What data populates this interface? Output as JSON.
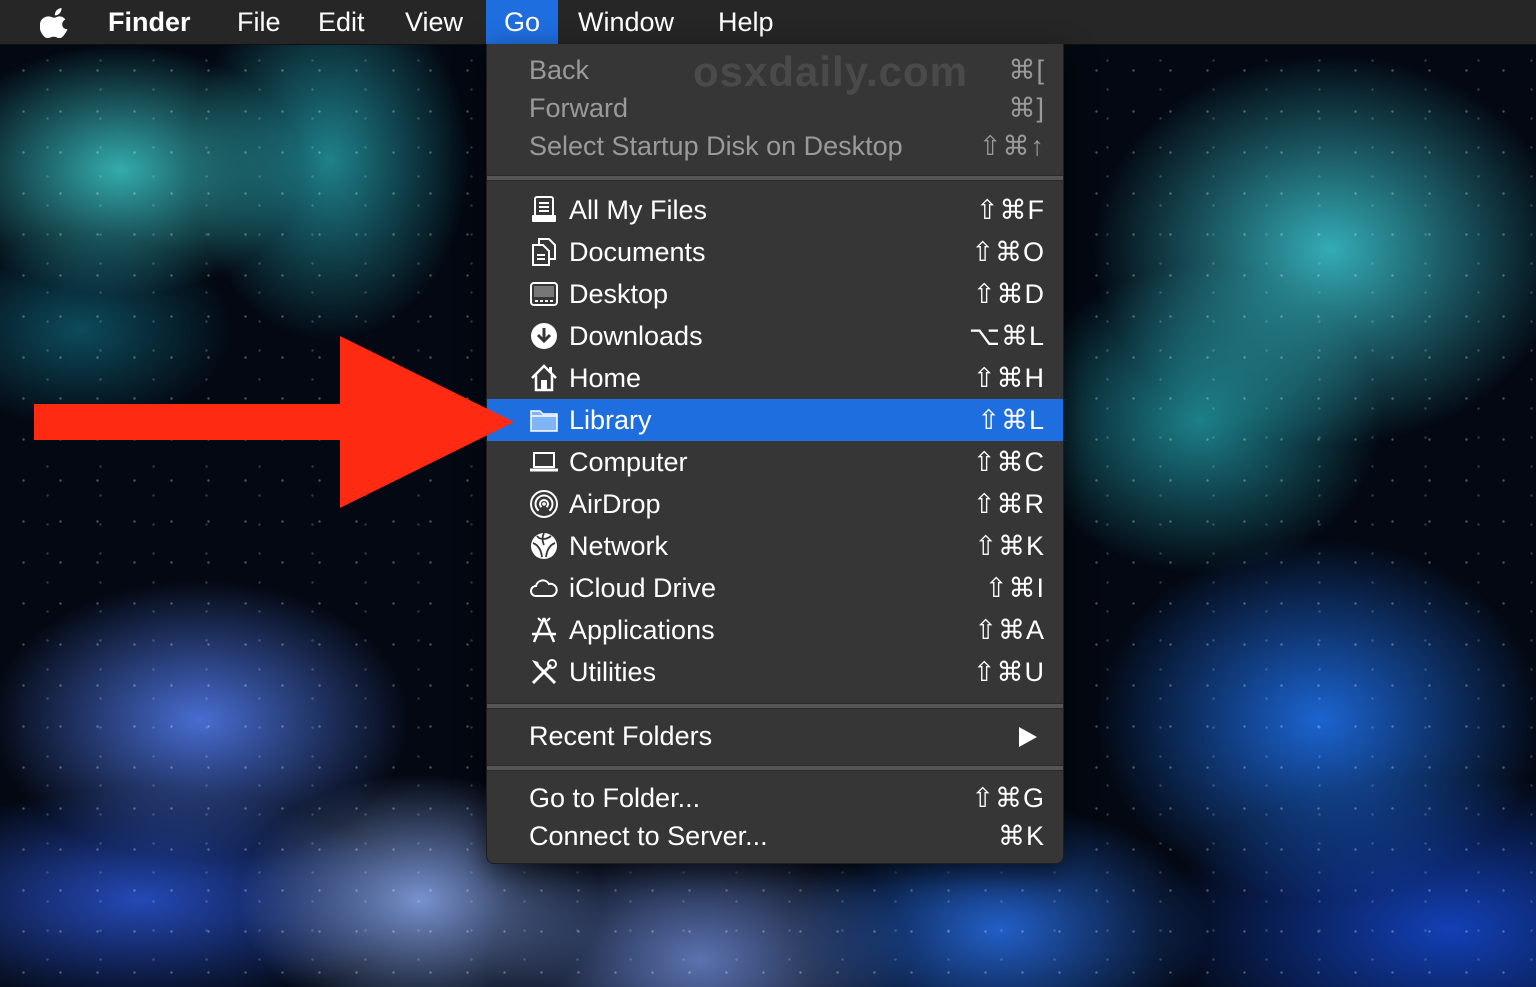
{
  "menubar": {
    "app_name": "Finder",
    "menus": [
      "File",
      "Edit",
      "View",
      "Go",
      "Window",
      "Help"
    ],
    "open_menu": "Go"
  },
  "watermark": "osxdaily.com",
  "go_menu": {
    "navigation": [
      {
        "label": "Back",
        "shortcut": "⌘[",
        "enabled": false
      },
      {
        "label": "Forward",
        "shortcut": "⌘]",
        "enabled": false
      },
      {
        "label": "Select Startup Disk on Desktop",
        "shortcut": "⇧⌘↑",
        "enabled": false
      }
    ],
    "places": [
      {
        "label": "All My Files",
        "shortcut": "⇧⌘F",
        "icon": "all-my-files-icon"
      },
      {
        "label": "Documents",
        "shortcut": "⇧⌘O",
        "icon": "documents-icon"
      },
      {
        "label": "Desktop",
        "shortcut": "⇧⌘D",
        "icon": "desktop-icon"
      },
      {
        "label": "Downloads",
        "shortcut": "⌥⌘L",
        "icon": "downloads-icon"
      },
      {
        "label": "Home",
        "shortcut": "⇧⌘H",
        "icon": "home-icon"
      },
      {
        "label": "Library",
        "shortcut": "⇧⌘L",
        "icon": "folder-icon",
        "highlighted": true
      },
      {
        "label": "Computer",
        "shortcut": "⇧⌘C",
        "icon": "computer-icon"
      },
      {
        "label": "AirDrop",
        "shortcut": "⇧⌘R",
        "icon": "airdrop-icon"
      },
      {
        "label": "Network",
        "shortcut": "⇧⌘K",
        "icon": "network-icon"
      },
      {
        "label": "iCloud Drive",
        "shortcut": "⇧⌘I",
        "icon": "cloud-icon"
      },
      {
        "label": "Applications",
        "shortcut": "⇧⌘A",
        "icon": "applications-icon"
      },
      {
        "label": "Utilities",
        "shortcut": "⇧⌘U",
        "icon": "utilities-icon"
      }
    ],
    "recent_folders": {
      "label": "Recent Folders"
    },
    "go_to_folder": {
      "label": "Go to Folder...",
      "shortcut": "⇧⌘G"
    },
    "connect_to_server": {
      "label": "Connect to Server...",
      "shortcut": "⌘K"
    }
  },
  "colors": {
    "menubar_bg": "#262626",
    "menu_bg": "#363636",
    "highlight": "#1f6ee0",
    "annotation_arrow": "#ff2a12"
  }
}
